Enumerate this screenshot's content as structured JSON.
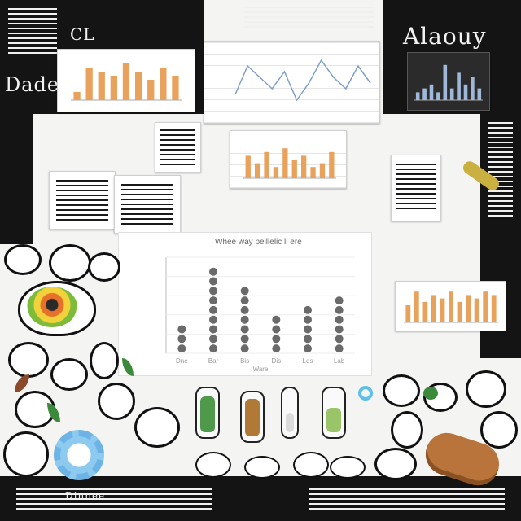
{
  "heading_main": "Whee way pelllelic ll ere",
  "heading_corner": "Alaouy",
  "heading_left": "Dadell",
  "xlabel": "Ware",
  "tag_top_left": "CL",
  "tag_bottom": "Dinnee",
  "colors": {
    "ink": "#111111",
    "paper": "#ffffff",
    "bar_orange": "#e8a25c",
    "bar_gray": "#6a6a6a",
    "line_blue": "#7f9fc8",
    "eye_yellow": "#f1d23a",
    "eye_green": "#7dbb3a",
    "eye_orange": "#e7702a",
    "tube_green": "#4f9a4a",
    "tube_brown": "#b07a36",
    "bread_brown": "#b8743a",
    "ring_blue": "#6db3e6"
  },
  "icons": [
    "eye-icon",
    "gear-icon",
    "test-tube-icon",
    "bottle-icon",
    "ring-icon",
    "leaf-icon"
  ],
  "chart_data": [
    {
      "type": "bar",
      "title": "Whee way pelllelic ll ere",
      "xlabel": "Ware",
      "ylabel": "",
      "categories": [
        "Dne",
        "Bar",
        "Bis",
        "Dis",
        "Lds",
        "Lab"
      ],
      "values": [
        3,
        9,
        7,
        4,
        5,
        6
      ],
      "ylim": [
        0,
        10
      ],
      "grid": true,
      "legend": "none"
    },
    {
      "type": "bar",
      "title": "",
      "categories": [],
      "values": [
        2,
        8,
        7,
        6,
        9,
        7,
        5,
        8,
        6
      ],
      "ylim": [
        0,
        10
      ]
    },
    {
      "type": "line",
      "title": "",
      "values": [
        3,
        8,
        6,
        4,
        7,
        2,
        5,
        9,
        6,
        4,
        8,
        5
      ],
      "ylim": [
        0,
        10
      ]
    },
    {
      "type": "bar",
      "title": "",
      "values": [
        6,
        4,
        7,
        3,
        8,
        5,
        6,
        3,
        4,
        7
      ],
      "ylim": [
        0,
        10
      ]
    },
    {
      "type": "bar",
      "title": "",
      "values": [
        2,
        3,
        4,
        2,
        9,
        3,
        7,
        4,
        6,
        3
      ],
      "ylim": [
        0,
        10
      ]
    },
    {
      "type": "bar",
      "title": "",
      "values": [
        5,
        9,
        6,
        8,
        7,
        9,
        6,
        8,
        7,
        9,
        8
      ],
      "ylim": [
        0,
        10
      ]
    }
  ]
}
